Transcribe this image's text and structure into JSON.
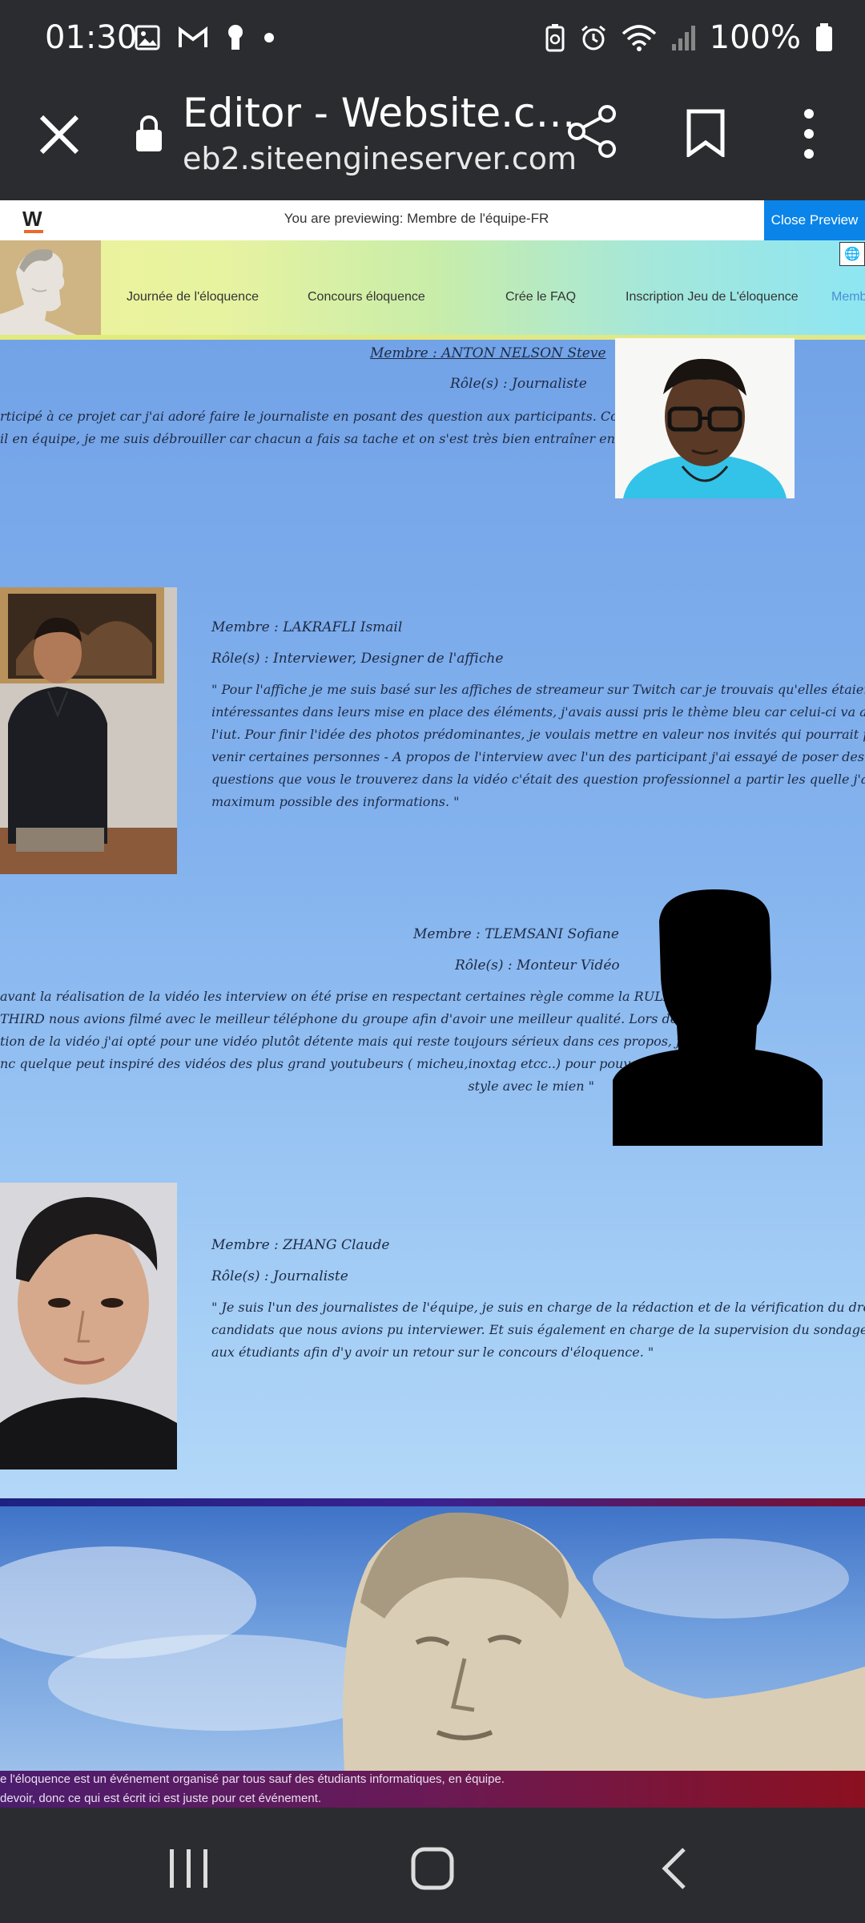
{
  "status_bar": {
    "time": "01:30",
    "battery": "100%",
    "left_icons": [
      "image-icon",
      "gmail-icon",
      "keyhole-icon",
      "dot-icon"
    ],
    "right_icons": [
      "battery-saver-icon",
      "alarm-icon",
      "wifi-icon",
      "signal-icon",
      "battery-icon"
    ]
  },
  "browser": {
    "title": "Editor - Website.c…",
    "url": "eb2.siteengineserver.com"
  },
  "preview_bar": {
    "logo": "W",
    "message": "You are previewing: Membre de l'équipe-FR",
    "close_label": "Close Preview"
  },
  "nav": {
    "items": [
      "Journée de l'éloquence",
      "Concours éloquence",
      "Crée le FAQ",
      "Inscription Jeu de L'éloquence",
      "Memb"
    ]
  },
  "members": [
    {
      "name": "Membre : ANTON NELSON Steve",
      "role": "Rôle(s) : Journaliste",
      "quote": [
        "rticipé à ce projet car j'ai adoré faire le journaliste en posant des question aux participants. Concernant",
        "il en équipe, je me suis débrouiller car chacun a fais sa tache et on s'est très bien entraîner entre nous\""
      ]
    },
    {
      "name": "Membre : LAKRAFLI Ismail",
      "role": "Rôle(s) : Interviewer, Designer de l'affiche",
      "quote": [
        "\" Pour l'affiche je me suis basé sur les affiches de streameur sur Twitch car je trouvais qu'elles étaient très",
        "intéressantes dans leurs mise en place des éléments, j'avais aussi pris le thème bleu car celui-ci va avec le logo de",
        "l'iut. Pour finir l'idée des photos prédominantes, je voulais mettre en valeur nos invités qui pourrait peut-être faire",
        "venir certaines personnes - A propos de l'interview avec l'un des participant j'ai essayé de poser des différents",
        "questions que vous le trouverez dans la vidéo c'était des question professionnel a partir les quelle j'ai pu tirer le",
        "maximum possible des informations. \""
      ]
    },
    {
      "name": "Membre : TLEMSANI Sofiane",
      "role": "Rôle(s) : Monteur Vidéo",
      "quote": [
        "avant la réalisation de la vidéo les interview on été prise en respectant certaines règle comme la RULE OF",
        "THIRD nous avions filmé avec le meilleur téléphone du groupe afin d'avoir une meilleur qualité. Lors de la",
        "tion de la vidéo j'ai opté pour une vidéo plutôt détente mais qui reste toujours sérieux dans ces propos, je me",
        "nc quelque peut inspiré des vidéos des plus grand youtubeurs ( micheu,inoxtag etcc..) pour pouvoir mixer se",
        "style avec le mien \""
      ]
    },
    {
      "name": "Membre : ZHANG Claude",
      "role": "Rôle(s) :  Journaliste",
      "quote": [
        "\" Je suis l'un des journalistes de l'équipe, je suis en charge de la rédaction et de la vérification du droit à l'image des",
        "candidats que nous avions pu interviewer. Et suis également en charge de la supervision du sondage qui fût adressé",
        "aux étudiants afin d'y avoir un retour sur le concours d'éloquence. \""
      ]
    }
  ],
  "footer": {
    "lines": [
      "e l'éloquence est un événement organisé par tous sauf des étudiants informatiques, en équipe.",
      "devoir, donc ce qui est écrit ici est juste pour cet événement."
    ]
  },
  "colors": {
    "chrome_bg": "#2b2c30",
    "preview_button": "#0a84e8",
    "text_dark": "#1d2a44"
  }
}
